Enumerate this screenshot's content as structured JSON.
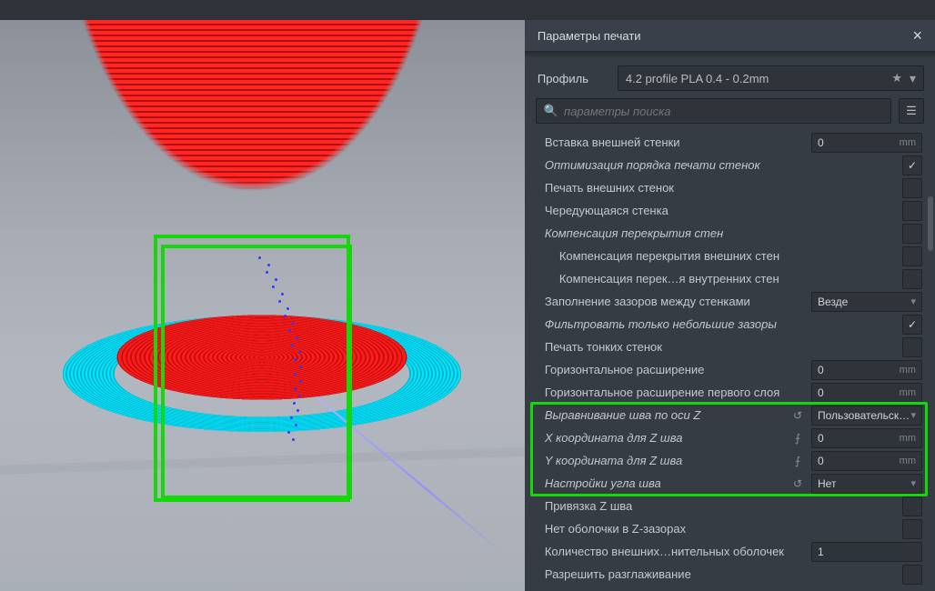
{
  "panel": {
    "title": "Параметры печати",
    "profile_label": "Профиль",
    "profile_value": "4.2 profile PLA 0.4 - 0.2mm",
    "search_placeholder": "параметры поиска"
  },
  "settings": [
    {
      "id": "outer_wall_inset",
      "label": "Вставка внешней стенки",
      "kind": "num",
      "value": "0",
      "unit": "mm"
    },
    {
      "id": "optimize_order",
      "label": "Оптимизация порядка печати стенок",
      "kind": "check",
      "checked": true,
      "italic": true
    },
    {
      "id": "outer_before_inner",
      "label": "Печать внешних стенок",
      "kind": "check",
      "checked": false
    },
    {
      "id": "alternate_wall",
      "label": "Чередующаяся стенка",
      "kind": "check",
      "checked": false
    },
    {
      "id": "comp_overlap",
      "label": "Компенсация перекрытия стен",
      "kind": "check",
      "checked": false,
      "italic": true
    },
    {
      "id": "comp_overlap_out",
      "label": "Компенсация перекрытия внешних стен",
      "kind": "check",
      "checked": false,
      "indent": true
    },
    {
      "id": "comp_overlap_in",
      "label": "Компенсация перек…я внутренних стен",
      "kind": "check",
      "checked": false,
      "indent": true
    },
    {
      "id": "fill_gaps",
      "label": "Заполнение зазоров между стенками",
      "kind": "select",
      "value": "Везде"
    },
    {
      "id": "filter_small",
      "label": "Фильтровать только небольшие зазоры",
      "kind": "check",
      "checked": true,
      "italic": true
    },
    {
      "id": "thin_walls",
      "label": "Печать тонких стенок",
      "kind": "check",
      "checked": false
    },
    {
      "id": "h_expand",
      "label": "Горизонтальное расширение",
      "kind": "num",
      "value": "0",
      "unit": "mm"
    },
    {
      "id": "h_expand_first",
      "label": "Горизонтальное расширение первого слоя",
      "kind": "num",
      "value": "0",
      "unit": "mm"
    },
    {
      "id": "z_seam_align",
      "label": "Выравнивание шва по оси Z",
      "kind": "select",
      "value": "Пользовательский",
      "italic": true,
      "action": "reset"
    },
    {
      "id": "z_seam_x",
      "label": "X координата для Z шва",
      "kind": "num",
      "value": "0",
      "unit": "mm",
      "italic": true,
      "action": "fx"
    },
    {
      "id": "z_seam_y",
      "label": "Y координата для Z шва",
      "kind": "num",
      "value": "0",
      "unit": "mm",
      "italic": true,
      "action": "fx"
    },
    {
      "id": "seam_corner",
      "label": "Настройки угла шва",
      "kind": "select",
      "value": "Нет",
      "italic": true,
      "action": "reset"
    },
    {
      "id": "z_seam_rel",
      "label": "Привязка Z шва",
      "kind": "check",
      "checked": false
    },
    {
      "id": "no_skin_z",
      "label": "Нет оболочки в Z-зазорах",
      "kind": "check",
      "checked": false
    },
    {
      "id": "extra_skin_walls",
      "label": "Количество внешних…нительных оболочек",
      "kind": "num",
      "value": "1",
      "unit": ""
    },
    {
      "id": "ironing",
      "label": "Разрешить разглаживание",
      "kind": "check",
      "checked": false
    }
  ],
  "highlight": {
    "start_id": "z_seam_align",
    "end_id": "seam_corner"
  }
}
